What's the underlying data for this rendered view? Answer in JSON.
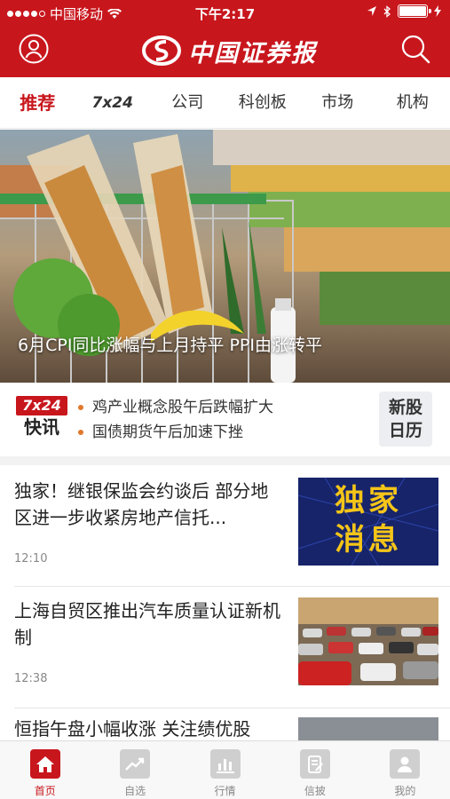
{
  "status": {
    "carrier": "中国移动",
    "time": "下午2:17"
  },
  "header": {
    "logo_text": "中国证券报"
  },
  "tabs": [
    {
      "label": "推荐",
      "active": true
    },
    {
      "label": "7x24"
    },
    {
      "label": "公司"
    },
    {
      "label": "科创板"
    },
    {
      "label": "市场"
    },
    {
      "label": "机构"
    }
  ],
  "hero": {
    "caption": "6月CPI同比涨幅与上月持平 PPI由涨转平"
  },
  "flash": {
    "badge": "7x24",
    "word": "快讯",
    "items": [
      "鸡产业概念股午后跌幅扩大",
      "国债期货午后加速下挫"
    ],
    "ipo_line1": "新股",
    "ipo_line2": "日历"
  },
  "news": [
    {
      "title": "独家！继银保监会约谈后 部分地区进一步收紧房地产信托...",
      "time": "12:10",
      "thumb_text": [
        "独家",
        "消息"
      ]
    },
    {
      "title": "上海自贸区推出汽车质量认证新机制",
      "time": "12:38"
    },
    {
      "title": "恒指午盘小幅收涨 关注绩优股"
    }
  ],
  "bottom_nav": [
    {
      "label": "首页",
      "icon": "home-icon",
      "active": true
    },
    {
      "label": "自选",
      "icon": "trend-icon"
    },
    {
      "label": "行情",
      "icon": "bar-chart-icon"
    },
    {
      "label": "信披",
      "icon": "document-icon"
    },
    {
      "label": "我的",
      "icon": "profile-icon"
    }
  ],
  "colors": {
    "brand": "#c8161d",
    "accent_dot": "#e0782a"
  }
}
